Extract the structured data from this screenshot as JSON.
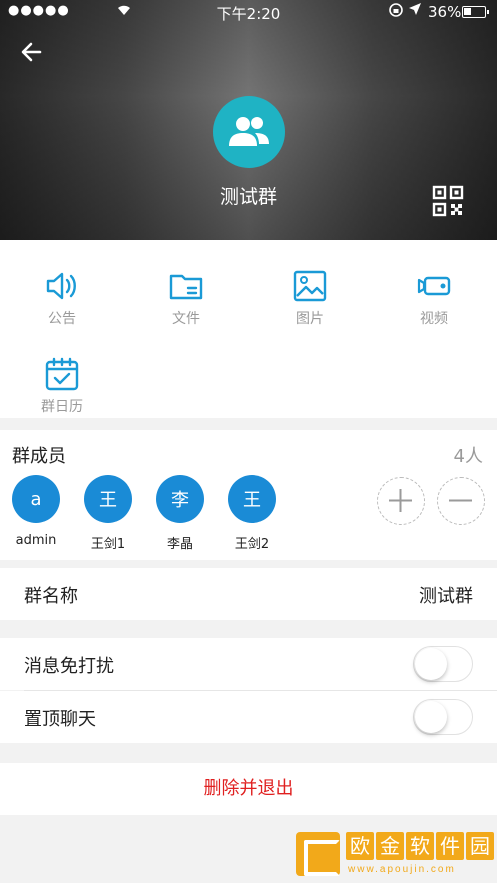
{
  "status_bar": {
    "signal": "●●●●●",
    "time": "下午2:20",
    "battery_pct": "36%"
  },
  "header": {
    "group_name": "测试群"
  },
  "features": [
    {
      "label": "公告",
      "icon": "announcement-icon"
    },
    {
      "label": "文件",
      "icon": "folder-icon"
    },
    {
      "label": "图片",
      "icon": "image-icon"
    },
    {
      "label": "视频",
      "icon": "video-icon"
    },
    {
      "label": "群日历",
      "icon": "calendar-icon"
    }
  ],
  "members": {
    "title": "群成员",
    "count": "4人",
    "list": [
      {
        "initial": "a",
        "name": "admin"
      },
      {
        "initial": "王",
        "name": "王剑1"
      },
      {
        "initial": "李",
        "name": "李晶"
      },
      {
        "initial": "王",
        "name": "王剑2"
      }
    ]
  },
  "group_name_row": {
    "label": "群名称",
    "value": "测试群"
  },
  "settings": [
    {
      "label": "消息免打扰",
      "on": false
    },
    {
      "label": "置顶聊天",
      "on": false
    }
  ],
  "delete_label": "删除并退出",
  "watermark": {
    "chars": [
      "欧",
      "金",
      "软",
      "件",
      "园"
    ],
    "url": "www.apoujin.com"
  },
  "colors": {
    "accent": "#1fb3c4",
    "member_avatar": "#1a8bd6",
    "danger": "#e02020",
    "icon_blue": "#1a9ad6"
  }
}
